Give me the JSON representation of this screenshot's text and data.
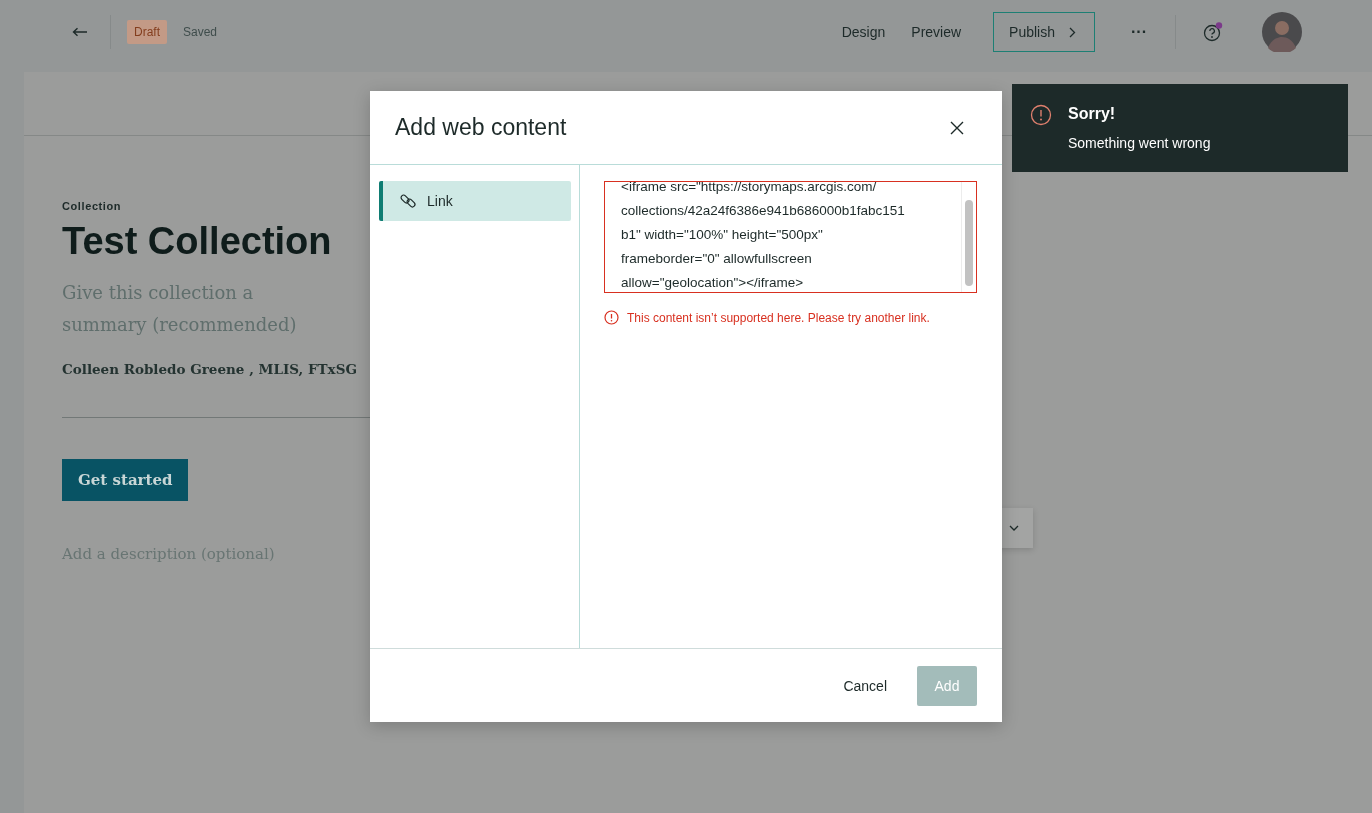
{
  "header": {
    "status_badge": "Draft",
    "save_status": "Saved",
    "nav": [
      {
        "label": "Design"
      },
      {
        "label": "Preview"
      }
    ],
    "publish_button": "Publish",
    "more_button": "···",
    "help_notification": true
  },
  "page": {
    "eyebrow": "Collection",
    "title": "Test Collection",
    "summary_placeholder": "Give this collection a summary (recommended)",
    "byline": "Colleen Robledo Greene , MLIS, FTxSG",
    "button": "Get started",
    "description_placeholder": "Add a description (optional)"
  },
  "dialog": {
    "title": "Add web content",
    "tabs": [
      {
        "label": "Link",
        "selected": true
      }
    ],
    "field": {
      "invalid": true,
      "value_lines": [
        "<iframe src=\"https://storymaps.arcgis.com/",
        "collections/42a24f6386e941b686000b1fabc151",
        "b1\" width=\"100%\" height=\"500px\"",
        "frameborder=\"0\" allowfullscreen",
        "allow=\"geolocation\"></iframe>"
      ]
    },
    "error_message": "This content isn’t supported here. Please try another link.",
    "buttons": [
      {
        "label": "Cancel",
        "kind": "text",
        "disabled": false
      },
      {
        "label": "Add",
        "kind": "primary",
        "disabled": true
      }
    ]
  },
  "toast": {
    "title": "Sorry!",
    "message": "Something went wrong"
  }
}
